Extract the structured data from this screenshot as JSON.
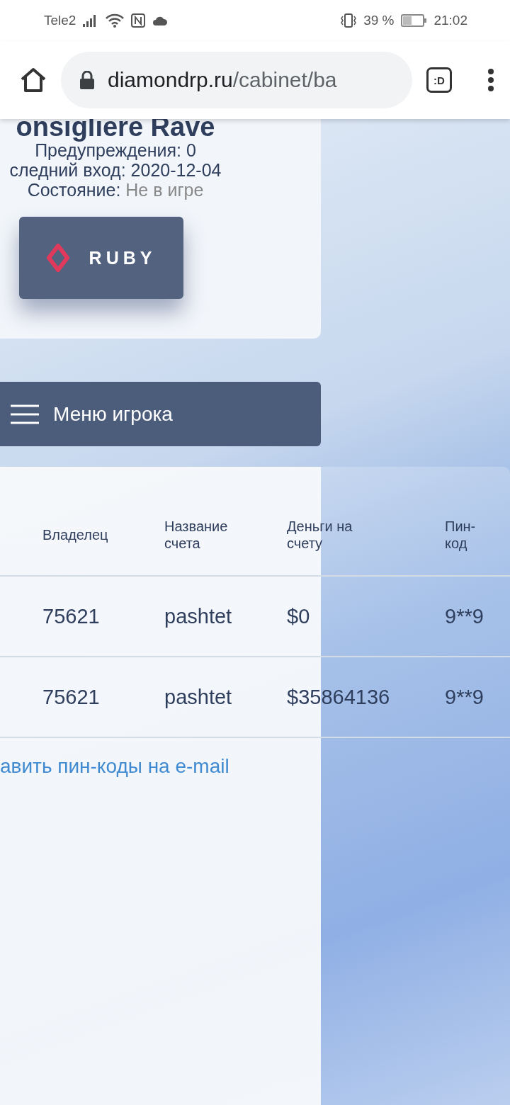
{
  "status_bar": {
    "carrier": "Tele2",
    "battery_percent": "39 %",
    "time": "21:02"
  },
  "browser": {
    "url_host": "diamondrp.ru",
    "url_path": "/cabinet/ba",
    "tab_switcher": ":D"
  },
  "profile": {
    "name": "onsigliere Rave",
    "warnings": "Предупреждения: 0",
    "last_login": "следний вход: 2020-12-04",
    "state_label": "Состояние:",
    "state_value": "Не в игре",
    "server_badge": "RUBY"
  },
  "player_menu": {
    "label": "Меню игрока"
  },
  "accounts_table": {
    "columns": [
      "Владелец",
      "Название счета",
      "Деньги на счету",
      "Пин-код"
    ],
    "rows": [
      [
        "75621",
        "pashtet",
        "$0",
        "9**9"
      ],
      [
        "75621",
        "pashtet",
        "$35864136",
        "9**9"
      ]
    ]
  },
  "email_link": "авить пин-коды на e-mail"
}
